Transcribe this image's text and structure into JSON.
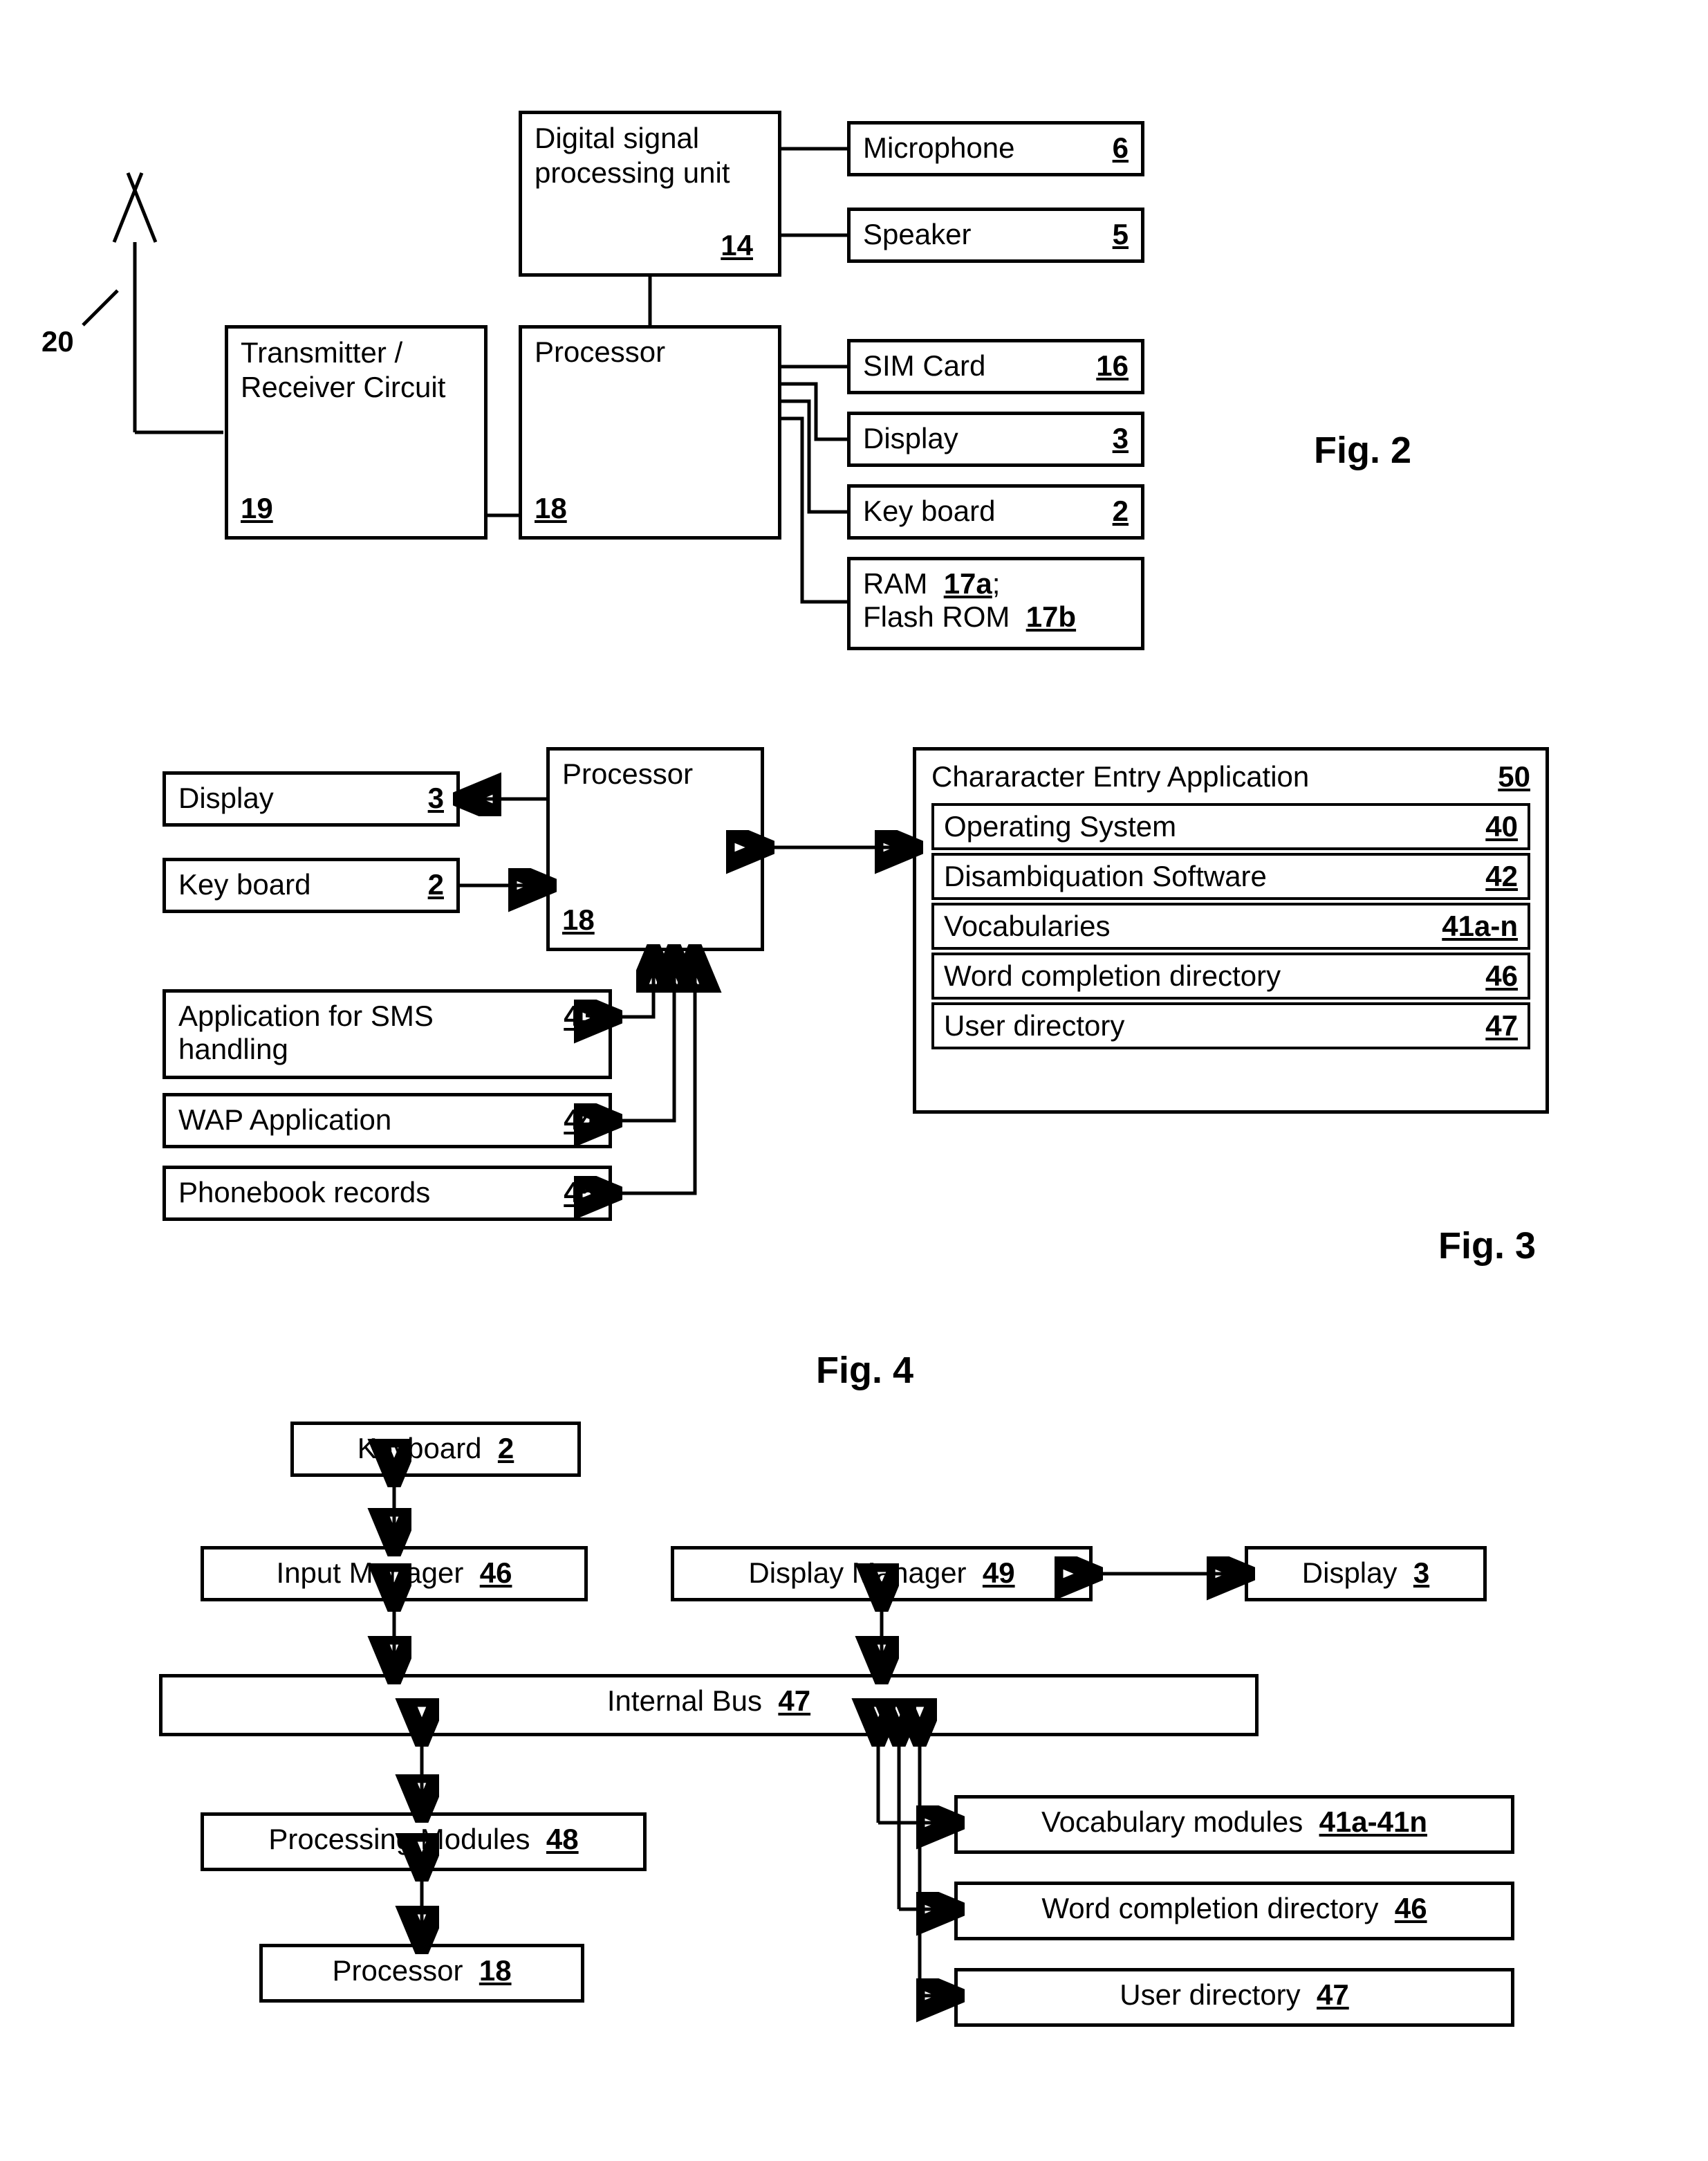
{
  "fig2": {
    "antenna_num": "20",
    "transmitter": {
      "label": "Transmitter / Receiver Circuit",
      "num": "19"
    },
    "dsp": {
      "label": "Digital signal processing unit",
      "num": "14"
    },
    "microphone": {
      "label": "Microphone",
      "num": "6"
    },
    "speaker": {
      "label": "Speaker",
      "num": "5"
    },
    "processor": {
      "label": "Processor",
      "num": "18"
    },
    "sim": {
      "label": "SIM Card",
      "num": "16"
    },
    "display": {
      "label": "Display",
      "num": "3"
    },
    "keyboard": {
      "label": "Key board",
      "num": "2"
    },
    "ram": {
      "line1a": "RAM",
      "line1b": "17a",
      "line2a": "Flash ROM",
      "line2b": "17b",
      "semi": ";"
    },
    "title": "Fig. 2"
  },
  "fig3": {
    "display": {
      "label": "Display",
      "num": "3"
    },
    "keyboard": {
      "label": "Key board",
      "num": "2"
    },
    "processor": {
      "label": "Processor",
      "num": "18"
    },
    "sms": {
      "label": "Application for SMS handling",
      "num": "43"
    },
    "wap": {
      "label": "WAP Application",
      "num": "44"
    },
    "phonebook": {
      "label": "Phonebook records",
      "num": "45"
    },
    "app": {
      "label": "Chararacter Entry Application",
      "num": "50"
    },
    "os": {
      "label": "Operating System",
      "num": "40"
    },
    "disamb": {
      "label": "Disambiquation Software",
      "num": "42"
    },
    "vocab": {
      "label": "Vocabularies",
      "num": "41a-n"
    },
    "wcd": {
      "label": "Word completion directory",
      "num": "46"
    },
    "userdir": {
      "label": "User directory",
      "num": "47"
    },
    "title": "Fig. 3"
  },
  "fig4": {
    "keyboard": {
      "label": "Keyboard",
      "num": "2"
    },
    "inputmgr": {
      "label": "Input Manager",
      "num": "46"
    },
    "dispmgr": {
      "label": "Display Manager",
      "num": "49"
    },
    "display": {
      "label": "Display",
      "num": "3"
    },
    "bus": {
      "label": "Internal Bus",
      "num": "47"
    },
    "procmod": {
      "label": "Processing Modules",
      "num": "48"
    },
    "processor": {
      "label": "Processor",
      "num": "18"
    },
    "vocabmod": {
      "label": "Vocabulary modules",
      "num": "41a-41n"
    },
    "wcd": {
      "label": "Word completion directory",
      "num": "46"
    },
    "userdir": {
      "label": "User directory",
      "num": "47"
    },
    "title": "Fig. 4"
  }
}
